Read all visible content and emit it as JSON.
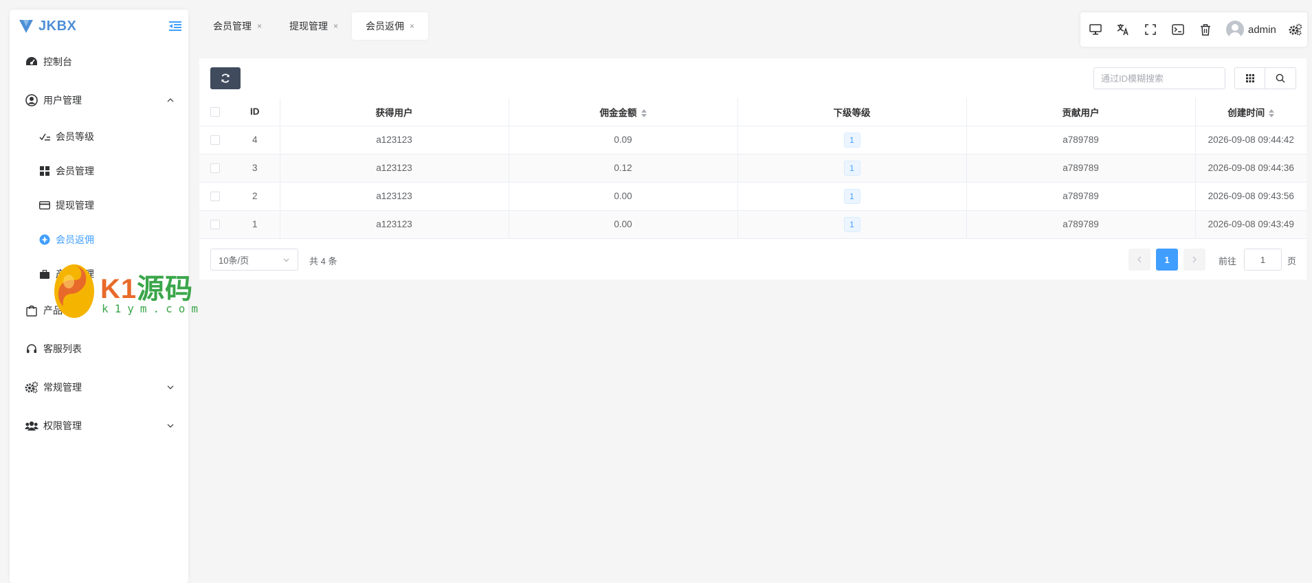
{
  "app": {
    "logo_text": "JKBX"
  },
  "sidebar": {
    "items": [
      {
        "label": "控制台"
      },
      {
        "label": "用户管理"
      },
      {
        "label": "会员等级"
      },
      {
        "label": "会员管理"
      },
      {
        "label": "提现管理"
      },
      {
        "label": "会员返佣"
      },
      {
        "label": "产品管理"
      },
      {
        "label": "产品"
      },
      {
        "label": "客服列表"
      },
      {
        "label": "常规管理"
      },
      {
        "label": "权限管理"
      }
    ],
    "active_label": "会员返佣"
  },
  "tabs": [
    {
      "label": "会员管理",
      "close": "×"
    },
    {
      "label": "提现管理",
      "close": "×"
    },
    {
      "label": "会员返佣",
      "close": "×"
    }
  ],
  "topbar": {
    "user_name": "admin"
  },
  "toolbar": {
    "search_placeholder": "通过ID模糊搜索"
  },
  "table": {
    "columns": [
      "ID",
      "获得用户",
      "佣金金额",
      "下级等级",
      "贡献用户",
      "创建时间"
    ],
    "rows": [
      {
        "id": "4",
        "user": "a123123",
        "amount": "0.09",
        "level": "1",
        "contributor": "a789789",
        "created": "2026-09-08 09:44:42"
      },
      {
        "id": "3",
        "user": "a123123",
        "amount": "0.12",
        "level": "1",
        "contributor": "a789789",
        "created": "2026-09-08 09:44:36"
      },
      {
        "id": "2",
        "user": "a123123",
        "amount": "0.00",
        "level": "1",
        "contributor": "a789789",
        "created": "2026-09-08 09:43:56"
      },
      {
        "id": "1",
        "user": "a123123",
        "amount": "0.00",
        "level": "1",
        "contributor": "a789789",
        "created": "2026-09-08 09:43:49"
      }
    ]
  },
  "pagination": {
    "page_size": "10条/页",
    "total": "共 4 条",
    "current_page": "1",
    "goto_label": "前往",
    "goto_value": "1",
    "page_suffix": "页"
  },
  "watermark": {
    "brand_k": "K1",
    "brand_cn": "源码",
    "url": "k1ym.com"
  },
  "colors": {
    "accent": "#409eff",
    "logo": "#4e8fd6",
    "refresh_button": "#404b5e"
  }
}
